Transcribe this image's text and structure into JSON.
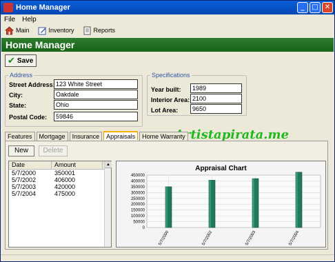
{
  "window": {
    "title": "Home Manager"
  },
  "menu": [
    "File",
    "Help"
  ],
  "toolbar": [
    {
      "label": "Main",
      "icon": "house-icon"
    },
    {
      "label": "Inventory",
      "icon": "pencil-note-icon"
    },
    {
      "label": "Reports",
      "icon": "report-icon"
    }
  ],
  "banner": {
    "title": "Home Manager"
  },
  "save": {
    "label": "Save"
  },
  "address": {
    "legend": "Address",
    "street_label": "Street Address:",
    "street": "123 White Street",
    "city_label": "City:",
    "city": "Oakdale",
    "state_label": "State:",
    "state": "Ohio",
    "postal_label": "Postal Code:",
    "postal": "59846"
  },
  "specs": {
    "legend": "Specifications",
    "year_label": "Year built:",
    "year": "1989",
    "interior_label": "Interior Area:",
    "interior": "2100",
    "lot_label": "Lot Area:",
    "lot": "9650"
  },
  "tabs": [
    "Features",
    "Mortgage",
    "Insurance",
    "Appraisals",
    "Home Warranty"
  ],
  "active_tab": "Appraisals",
  "buttons": {
    "new": "New",
    "delete": "Delete"
  },
  "table": {
    "headers": [
      "Date",
      "Amount"
    ],
    "rows": [
      [
        "5/7/2000",
        "350001"
      ],
      [
        "5/7/2002",
        "406000"
      ],
      [
        "5/7/2003",
        "420000"
      ],
      [
        "5/7/2004",
        "475000"
      ]
    ]
  },
  "watermark": "Artistapirata.me",
  "chart_data": {
    "type": "bar",
    "title": "Appraisal Chart",
    "categories": [
      "5/7/2000",
      "5/7/2002",
      "5/7/2003",
      "5/7/2004"
    ],
    "values": [
      350001,
      406000,
      420000,
      475000
    ],
    "ylim": [
      0,
      450000
    ],
    "yticks": [
      0,
      50000,
      100000,
      150000,
      200000,
      250000,
      300000,
      350000,
      400000,
      450000
    ],
    "grid": true,
    "bar_color": "#1E7A5A"
  }
}
